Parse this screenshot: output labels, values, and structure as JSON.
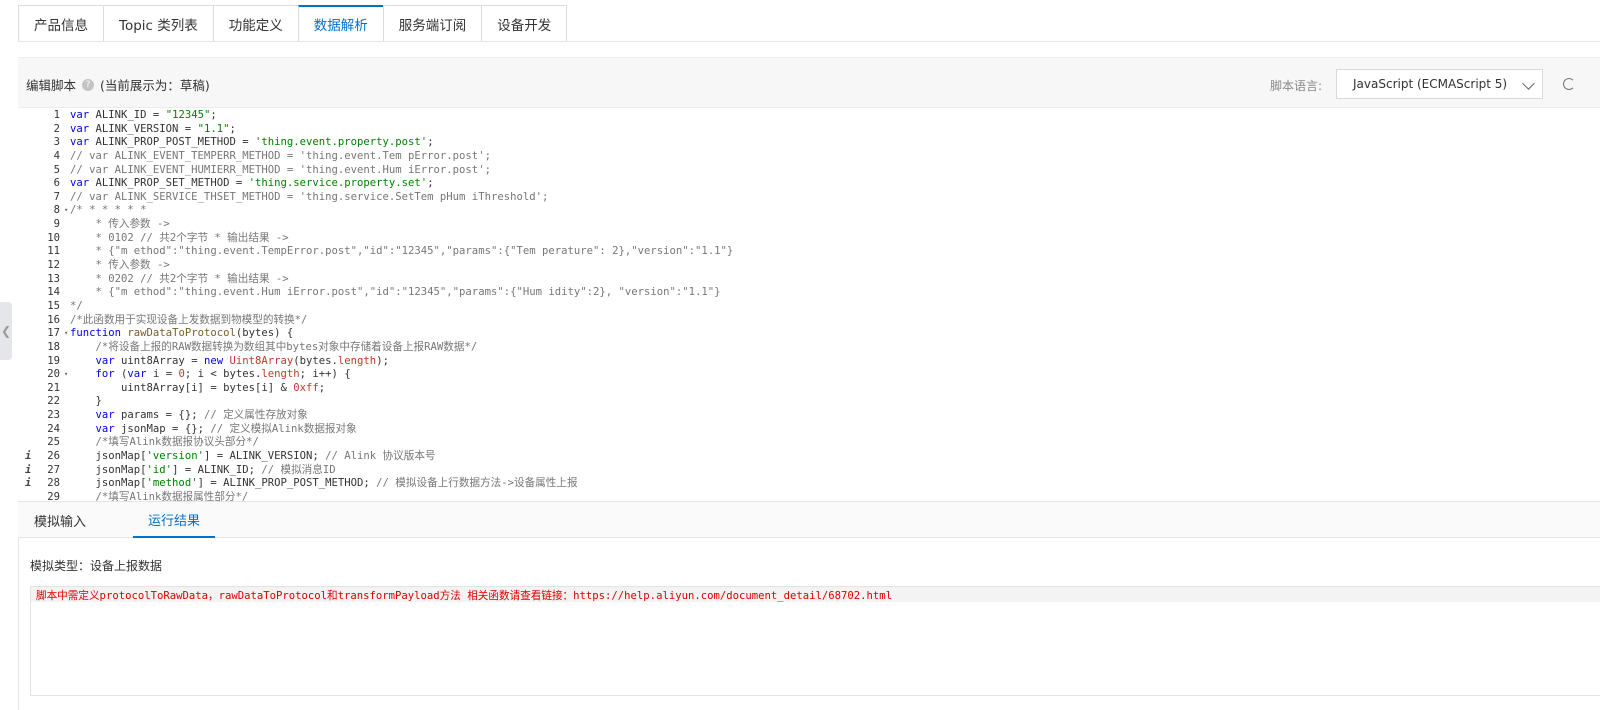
{
  "tabs": [
    {
      "label": "产品信息"
    },
    {
      "label": "Topic 类列表"
    },
    {
      "label": "功能定义"
    },
    {
      "label": "数据解析"
    },
    {
      "label": "服务端订阅"
    },
    {
      "label": "设备开发"
    }
  ],
  "active_tab": "数据解析",
  "editor": {
    "title": "编辑脚本",
    "help_icon": "?",
    "status": "(当前展示为：草稿)",
    "lang_label": "脚本语言:",
    "lang_value": "JavaScript (ECMAScript 5)"
  },
  "code_lines": [
    {
      "n": "1",
      "text": "var ALINK_ID = \"12345\";"
    },
    {
      "n": "2",
      "text": "var ALINK_VERSION = \"1.1\";"
    },
    {
      "n": "3",
      "text": "var ALINK_PROP_POST_METHOD = 'thing.event.property.post';"
    },
    {
      "n": "4",
      "text": "// var ALINK_EVENT_TEMPERR_METHOD = 'thing.event.Tem pError.post';"
    },
    {
      "n": "5",
      "text": "// var ALINK_EVENT_HUMIERR_METHOD = 'thing.event.Hum iError.post';"
    },
    {
      "n": "6",
      "text": "var ALINK_PROP_SET_METHOD = 'thing.service.property.set';"
    },
    {
      "n": "7",
      "text": "// var ALINK_SERVICE_THSET_METHOD = 'thing.service.SetTem pHum iThreshold';"
    },
    {
      "n": "8",
      "text": "/* * * * * *",
      "fold": true
    },
    {
      "n": "9",
      "text": "    * 传入参数 ->"
    },
    {
      "n": "10",
      "text": "    * 0102 // 共2个字节 * 输出结果 ->"
    },
    {
      "n": "11",
      "text": "    * {\"m ethod\":\"thing.event.TempError.post\",\"id\":\"12345\",\"params\":{\"Tem perature\": 2},\"version\":\"1.1\"}"
    },
    {
      "n": "12",
      "text": "    * 传入参数 ->"
    },
    {
      "n": "13",
      "text": "    * 0202 // 共2个字节 * 输出结果 ->"
    },
    {
      "n": "14",
      "text": "    * {\"m ethod\":\"thing.event.Hum iError.post\",\"id\":\"12345\",\"params\":{\"Hum idity\":2}, \"version\":\"1.1\"}"
    },
    {
      "n": "15",
      "text": "*/"
    },
    {
      "n": "16",
      "text": "/*此函数用于实现设备上发数据到物模型的转换*/"
    },
    {
      "n": "17",
      "text": "function rawDataToProtocol(bytes) {",
      "fold": true
    },
    {
      "n": "18",
      "text": "    /*将设备上报的RAW数据转换为数组其中bytes对象中存储着设备上报RAW数据*/"
    },
    {
      "n": "19",
      "text": "    var uint8Array = new Uint8Array(bytes.length);"
    },
    {
      "n": "20",
      "text": "    for (var i = 0; i < bytes.length; i++) {",
      "fold": true
    },
    {
      "n": "21",
      "text": "        uint8Array[i] = bytes[i] & 0xff;"
    },
    {
      "n": "22",
      "text": "    }"
    },
    {
      "n": "23",
      "text": "    var params = {}; // 定义属性存放对象"
    },
    {
      "n": "24",
      "text": "    var jsonMap = {}; // 定义模拟Alink数据报对象"
    },
    {
      "n": "25",
      "text": "    /*填写Alink数据报协议头部分*/"
    },
    {
      "n": "26",
      "text": "    jsonMap['version'] = ALINK_VERSION; // Alink 协议版本号",
      "info": "i"
    },
    {
      "n": "27",
      "text": "    jsonMap['id'] = ALINK_ID; // 模拟消息ID",
      "info": "i"
    },
    {
      "n": "28",
      "text": "    jsonMap['method'] = ALINK_PROP_POST_METHOD; // 模拟设备上行数据方法->设备属性上报",
      "info": "i"
    },
    {
      "n": "29",
      "text": "    /*填写Alink数据报属性部分*/"
    }
  ],
  "bottom_tabs": [
    {
      "label": "模拟输入"
    },
    {
      "label": "运行结果"
    }
  ],
  "active_bottom_tab": "运行结果",
  "sim_type": "模拟类型：设备上报数据",
  "result_message": "脚本中需定义protocolToRawData，rawDataToProtocol和transformPayload方法 相关函数请查看链接：https://help.aliyun.com/document_detail/68702.html",
  "colors": {
    "accent": "#0070cc",
    "error": "#e00000"
  }
}
